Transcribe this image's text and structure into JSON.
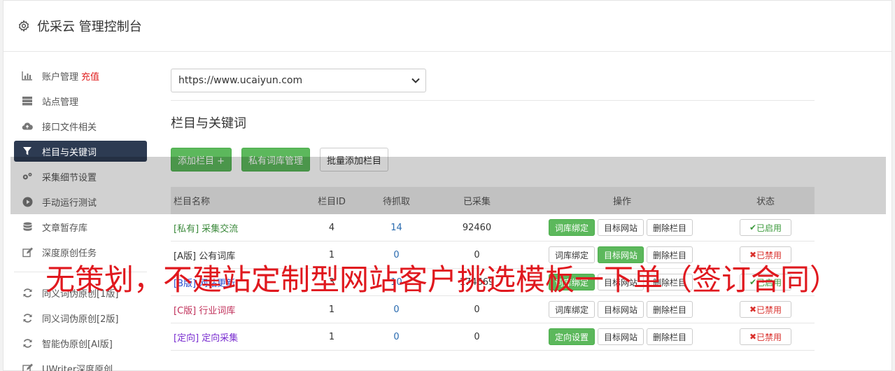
{
  "header": {
    "title": "优采云 管理控制台"
  },
  "sidebar": {
    "items": [
      {
        "label": "账户管理",
        "extra": "充值",
        "icon": "bar-chart-icon"
      },
      {
        "label": "站点管理",
        "icon": "server-icon"
      },
      {
        "label": "接口文件相关",
        "icon": "cloud-upload-icon"
      },
      {
        "label": "栏目与关键词",
        "icon": "filter-icon",
        "active": true
      },
      {
        "label": "采集细节设置",
        "icon": "gears-icon"
      },
      {
        "label": "手动运行测试",
        "icon": "play-circle-icon"
      },
      {
        "label": "文章暂存库",
        "icon": "database-icon"
      },
      {
        "label": "深度原创任务",
        "icon": "edit-icon"
      }
    ],
    "items2": [
      {
        "label": "同义词伪原创[1版]",
        "icon": "refresh-icon"
      },
      {
        "label": "同义词伪原创[2版]",
        "icon": "refresh-icon"
      },
      {
        "label": "智能伪原创[AI版]",
        "icon": "refresh-icon"
      },
      {
        "label": "UWriter深度原创",
        "icon": "edit-icon"
      }
    ]
  },
  "main": {
    "site_select": "https://www.ucaiyun.com",
    "section_title": "栏目与关键词",
    "buttons": {
      "add_column": "添加栏目 +",
      "private_lib": "私有词库管理",
      "batch_add": "批量添加栏目"
    },
    "table": {
      "headers": {
        "name": "栏目名称",
        "id": "栏目ID",
        "wait": "待抓取",
        "done": "已采集",
        "ops": "操作",
        "status": "状态"
      },
      "rows": [
        {
          "tag": "[私有]",
          "name": "采集交流",
          "id": "4",
          "wait": "14",
          "done": "92460",
          "op1": "词库绑定",
          "op2": "目标网站",
          "op3": "删除栏目",
          "status": "已启用"
        },
        {
          "tag": "[A版]",
          "name": "公有词库",
          "id": "1",
          "wait": "0",
          "done": "0",
          "op1": "词库绑定",
          "op2": "目标网站",
          "op3": "删除栏目",
          "status": "已禁用"
        },
        {
          "tag": "[B版]",
          "name": "网站更新",
          "id": "3",
          "wait": "10",
          "done": "174669",
          "op1": "词库绑定",
          "op2": "目标网站",
          "op3": "删除栏目",
          "status": "已启用"
        },
        {
          "tag": "[C版]",
          "name": "行业词库",
          "id": "1",
          "wait": "0",
          "done": "0",
          "op1": "词库绑定",
          "op2": "目标网站",
          "op3": "删除栏目",
          "status": "已禁用"
        },
        {
          "tag": "[定向]",
          "name": "定向采集",
          "id": "1",
          "wait": "0",
          "done": "0",
          "op1": "定向设置",
          "op2": "目标网站",
          "op3": "删除栏目",
          "status": "已禁用"
        }
      ]
    }
  },
  "watermark": "无策划，不建站定制型网站客户挑选模板一下单（签订合同）"
}
